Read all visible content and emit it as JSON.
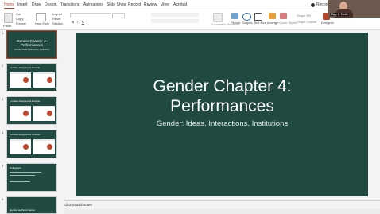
{
  "menu_tabs": [
    "Home",
    "Insert",
    "Draw",
    "Design",
    "Transitions",
    "Animations",
    "Slide Show",
    "Record",
    "Review",
    "View",
    "Acrobat"
  ],
  "record_label": "Record",
  "ribbon": {
    "paste": "Paste",
    "cut": "Cut",
    "copy": "Copy",
    "format": "Format",
    "new_slide": "New Slide",
    "reuse_slides": "Reuse Slides",
    "layout": "Layout",
    "reset": "Reset",
    "section": "Section",
    "convert_smartart": "Convert to SmartArt",
    "picture": "Picture",
    "shapes": "Shapes",
    "text_box": "Text Box",
    "arrange": "Arrange",
    "quick_styles": "Quick Styles",
    "shape_fill": "Shape Fill",
    "shape_outline": "Shape Outline",
    "designer": "Designer"
  },
  "participant_name": "Mary L. Smith",
  "thumbnails": [
    {
      "num": "1",
      "title": "Gender Chapter 4: Performances",
      "subtitle": "Gender: Ideas, Interactions, Institutions"
    },
    {
      "num": "2",
      "title": "In-Class Assignment Results"
    },
    {
      "num": "3",
      "title": "In-Class Assignment Results"
    },
    {
      "num": "4",
      "title": "In-Class Assignment Results"
    },
    {
      "num": "5",
      "title": "Reflections"
    },
    {
      "num": "6",
      "title": "Gender as Performance"
    }
  ],
  "slide": {
    "title_line1": "Gender Chapter 4:",
    "title_line2": "Performances",
    "subtitle": "Gender: Ideas, Interactions, Institutions",
    "bg_color": "#1f4941"
  },
  "notes_placeholder": "Click to add notes",
  "accent_color": "#b7472a"
}
